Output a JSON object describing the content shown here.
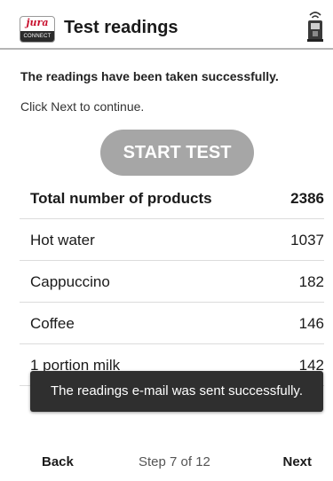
{
  "header": {
    "title": "Test readings",
    "logo_brand": "jura",
    "logo_tag": "CONNECT",
    "device_icon": "coffee-machine-wireless-icon"
  },
  "messages": {
    "success": "The readings have been taken successfully.",
    "continue": "Click Next to continue."
  },
  "start_button": {
    "label": "START TEST",
    "enabled": false
  },
  "products": {
    "total": {
      "name": "Total number of products",
      "value": "2386"
    },
    "items": [
      {
        "name": "Hot water",
        "value": "1037"
      },
      {
        "name": "Cappuccino",
        "value": "182"
      },
      {
        "name": "Coffee",
        "value": "146"
      },
      {
        "name": "1 portion milk",
        "value": "142"
      }
    ]
  },
  "toast": {
    "text": "The readings e-mail was sent successfully."
  },
  "footer": {
    "back": "Back",
    "step": "Step 7 of 12",
    "next": "Next"
  },
  "colors": {
    "brand_red": "#c8102e",
    "button_disabled": "#a6a6a6",
    "toast_bg": "#2f2f2f"
  }
}
